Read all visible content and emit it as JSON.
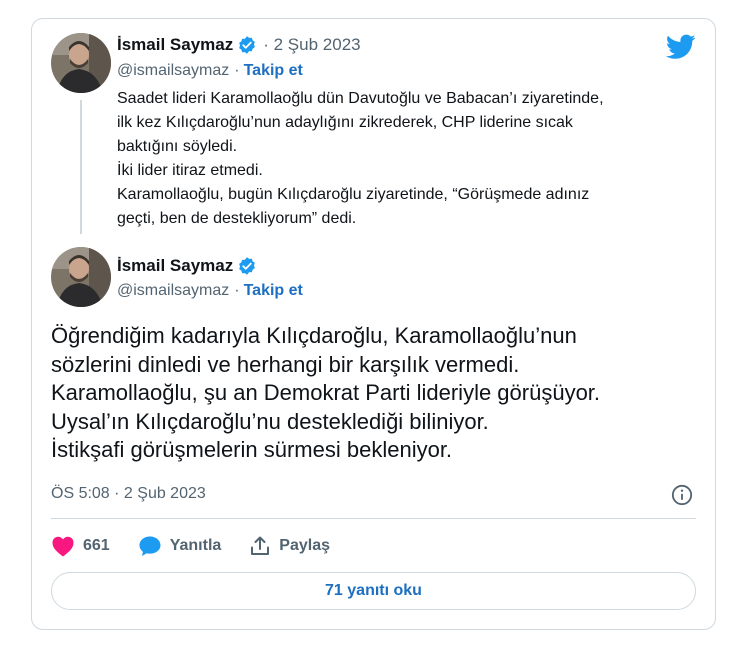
{
  "colors": {
    "accent": "#1d9bf0",
    "link": "#1d6fc2",
    "text": "#0f1419",
    "secondary": "#536471",
    "border": "#cfd9de",
    "like": "#f91880"
  },
  "icons": {
    "brand": "twitter-bird-icon",
    "verified": "verified-badge-icon",
    "info": "info-icon",
    "like": "heart-icon",
    "reply": "speech-bubble-icon",
    "share": "share-upload-icon"
  },
  "quoted_tweet": {
    "author_name": "İsmail Saymaz",
    "date": "· 2 Şub 2023",
    "handle": "@ismailsaymaz",
    "follow_separator": "·",
    "follow_label": "Takip et",
    "text_lines": [
      "Saadet lideri Karamollaoğlu dün Davutoğlu ve Babacan’ı ziyaretinde,",
      "ilk kez Kılıçdaroğlu’nun adaylığını zikrederek, CHP liderine sıcak",
      "baktığını söyledi.",
      "İki lider itiraz etmedi.",
      "Karamollaoğlu, bugün Kılıçdaroğlu ziyaretinde, “Görüşmede adınız",
      "geçti, ben de destekliyorum” dedi."
    ]
  },
  "main_tweet": {
    "author_name": "İsmail Saymaz",
    "handle": "@ismailsaymaz",
    "follow_separator": "·",
    "follow_label": "Takip et",
    "text_lines": [
      "Öğrendiğim kadarıyla Kılıçdaroğlu, Karamollaoğlu’nun",
      "sözlerini dinledi ve herhangi bir karşılık vermedi.",
      "Karamollaoğlu, şu an Demokrat Parti lideriyle görüşüyor.",
      "Uysal’ın Kılıçdaroğlu’nu desteklediği biliniyor.",
      "İstikşafi görüşmelerin sürmesi bekleniyor."
    ],
    "timestamp": "ÖS 5:08 · 2 Şub 2023"
  },
  "actions": {
    "like_count": "661",
    "reply_label": "Yanıtla",
    "share_label": "Paylaş"
  },
  "read_replies_label": "71 yanıtı oku"
}
